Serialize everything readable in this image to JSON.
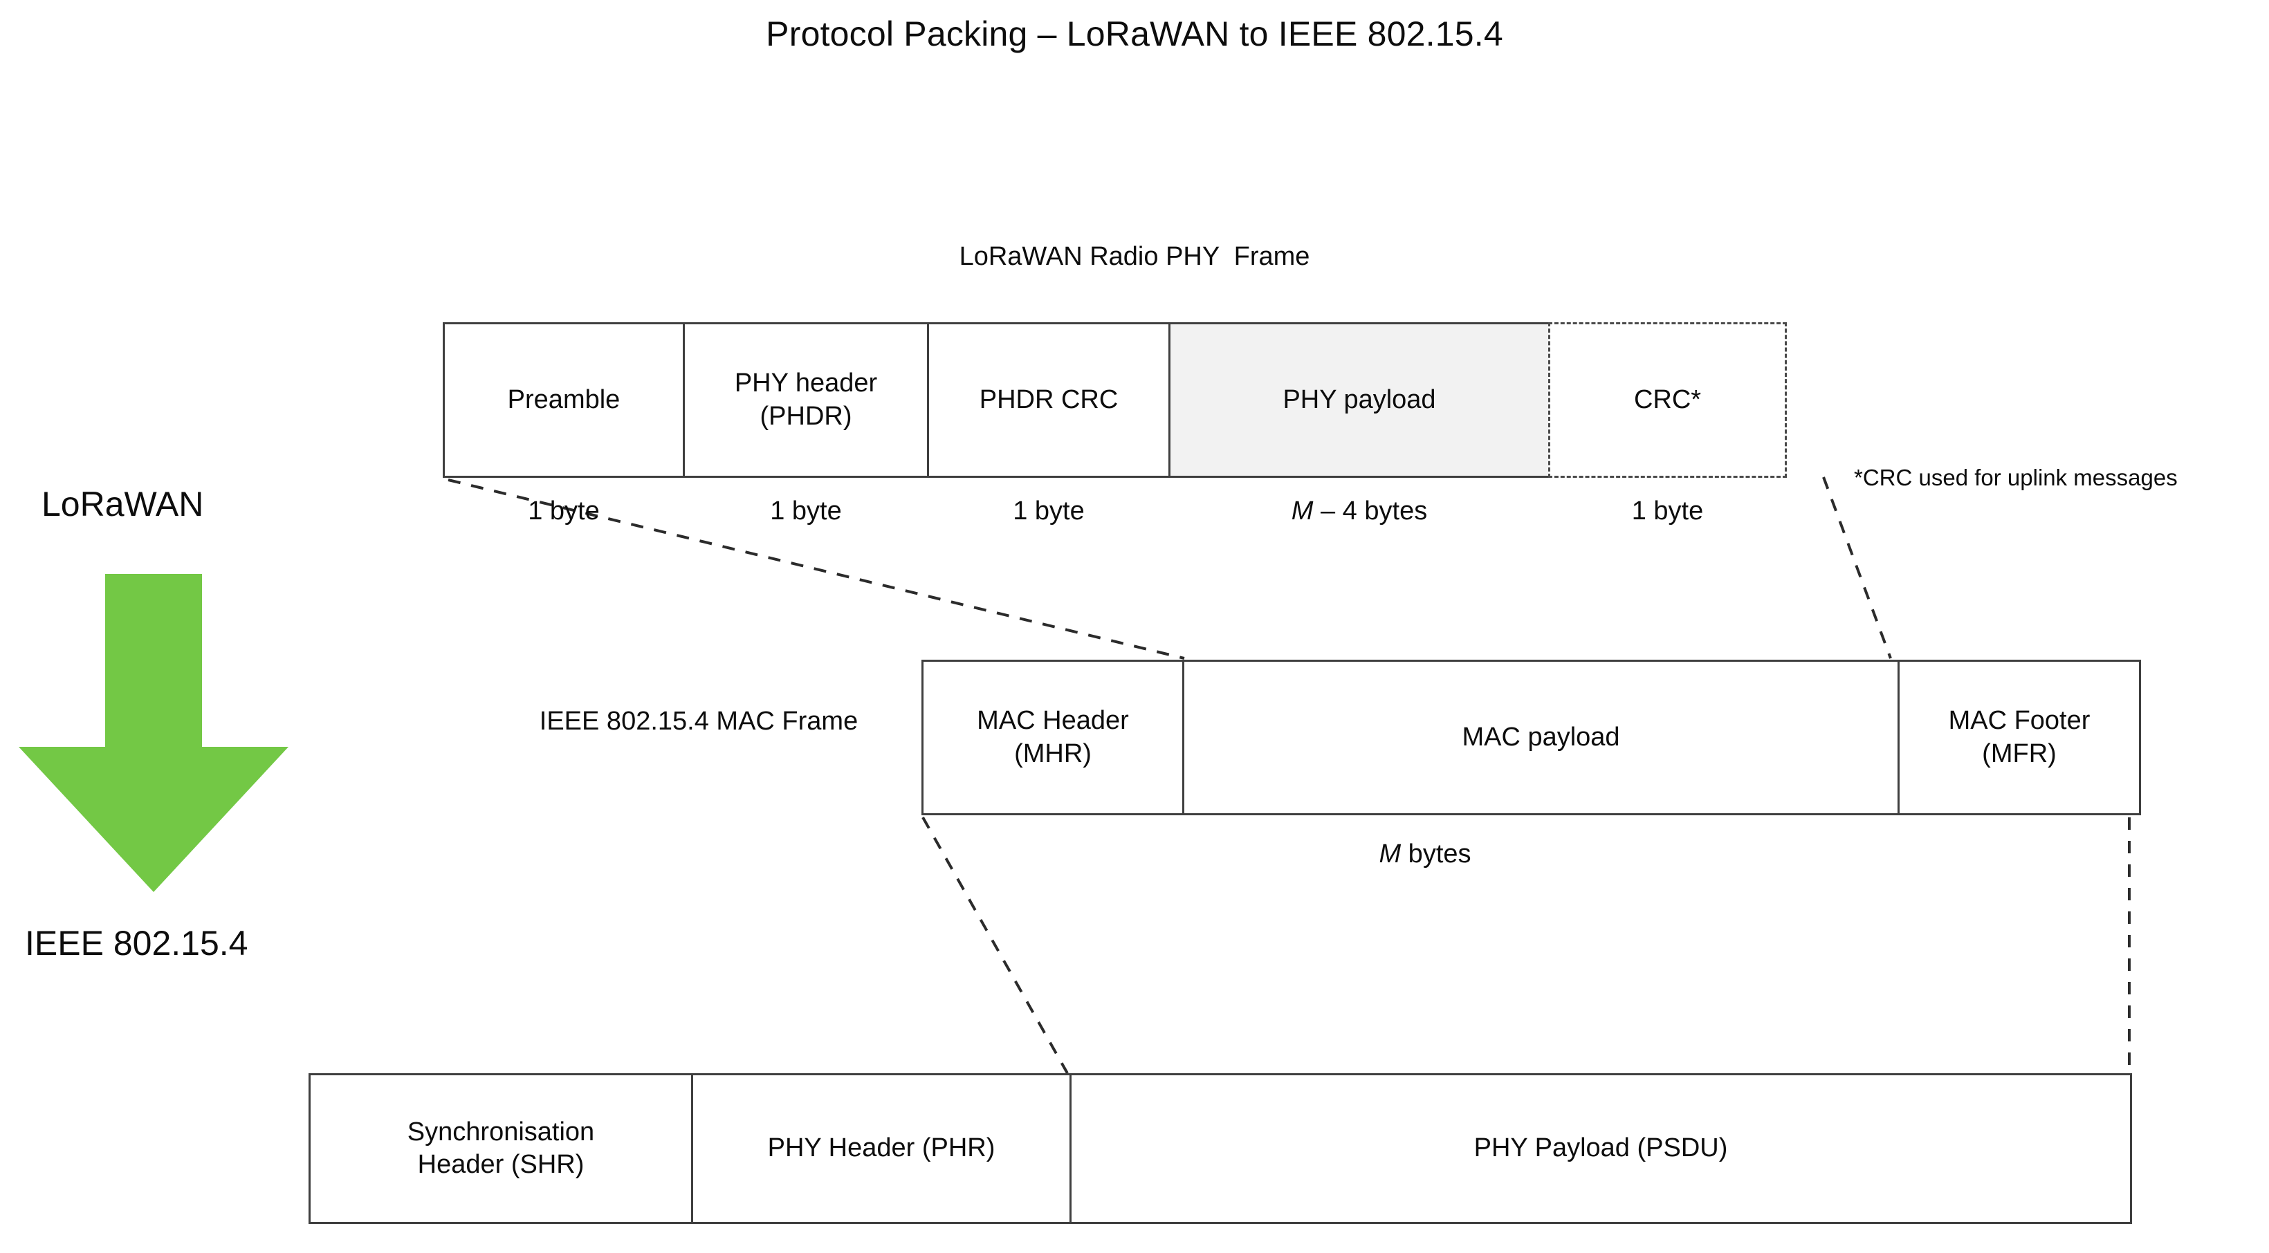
{
  "title": "Protocol Packing – LoRaWAN to IEEE 802.15.4",
  "side_labels": {
    "top": "LoRaWAN",
    "bottom": "IEEE 802.15.4",
    "arrow_icon": "down-arrow-icon",
    "arrow_color": "#73c845"
  },
  "rows": {
    "lorawan_phy": {
      "caption": "LoRaWAN Radio PHY  Frame",
      "cells": [
        {
          "label": "Preamble",
          "size": "1 byte",
          "style": "solid"
        },
        {
          "label": "PHY header\n(PHDR)",
          "size": "1 byte",
          "style": "solid"
        },
        {
          "label": "PHDR CRC",
          "size": "1 byte",
          "style": "solid"
        },
        {
          "label": "PHY payload",
          "size": "M – 4 bytes",
          "size_italic_prefix": "M",
          "size_rest": " – 4 bytes",
          "style": "shaded"
        },
        {
          "label": "CRC*",
          "size": "1 byte",
          "style": "dashed"
        }
      ],
      "footnote": "*CRC used for uplink messages"
    },
    "ieee_mac": {
      "caption": "IEEE 802.15.4 MAC\nFrame",
      "cells": [
        {
          "label": "MAC Header\n(MHR)",
          "style": "solid"
        },
        {
          "label": "MAC payload",
          "style": "solid"
        },
        {
          "label": "MAC Footer\n(MFR)",
          "style": "solid"
        }
      ],
      "size_total_italic_prefix": "M",
      "size_total_rest": " bytes",
      "size_total": "M bytes"
    },
    "ieee_phy": {
      "cells": [
        {
          "label": "Synchronisation\nHeader (SHR)",
          "style": "solid"
        },
        {
          "label": "PHY Header (PHR)",
          "style": "solid"
        },
        {
          "label": "PHY Payload (PSDU)",
          "style": "solid"
        }
      ]
    }
  },
  "colors": {
    "border": "#3f3f3f",
    "shaded_fill": "#f2f2f2",
    "dashed_border": "#4a4a4a",
    "text": "#0d0d0d",
    "arrow_green": "#73c845"
  }
}
